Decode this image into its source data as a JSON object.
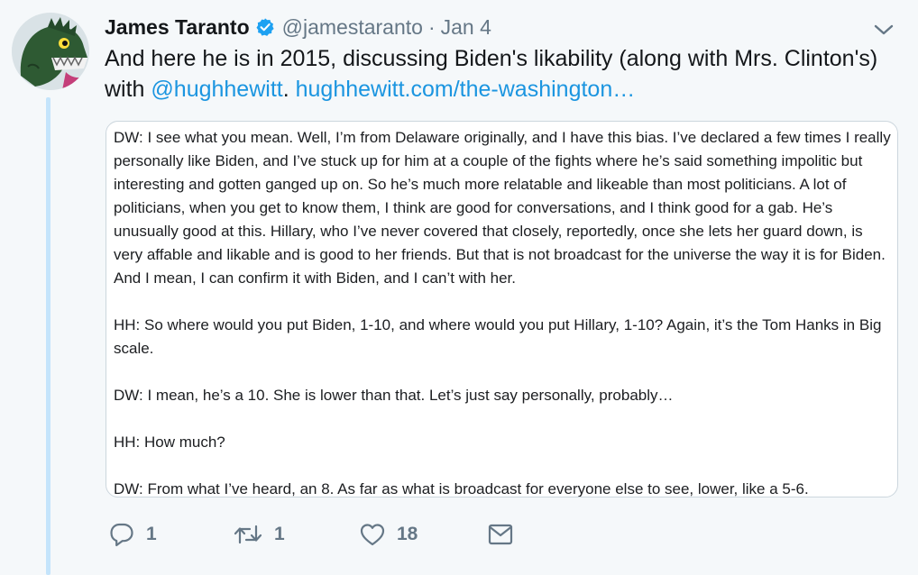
{
  "tweet": {
    "author_name": "James Taranto",
    "handle": "@jamestaranto",
    "separator": "·",
    "date": "Jan 4",
    "text_main": "And here he is in 2015, discussing Biden's likability (along with Mrs. Clinton's) with ",
    "mention": "@hughhewitt",
    "text_sep": ". ",
    "link": "hughhewitt.com/the-washington…"
  },
  "quote": {
    "paragraphs": [
      "DW: I see what you mean. Well, I’m from Delaware originally, and I have this bias. I’ve declared a few times I really personally like Biden, and I’ve stuck up for him at a couple of the fights where he’s said something impolitic but interesting and gotten ganged up on. So he’s much more relatable and likeable than most politicians. A lot of politicians, when you get to know them, I think are good for conversations, and I think good for a gab. He’s unusually good at this. Hillary, who I’ve never covered that closely, reportedly, once she lets her guard down, is very affable and likable and is good to her friends. But that is not broadcast for the universe the way it is for Biden. And I mean, I can confirm it with Biden, and I can’t with her.",
      "HH: So where would you put Biden, 1-10, and where would you put Hillary, 1-10? Again, it’s the Tom Hanks in Big scale.",
      "DW: I mean, he’s a 10. She is lower than that. Let’s just say personally, probably…",
      "HH: How much?",
      "DW: From what I’ve heard, an 8. As far as what is broadcast for everyone else to see, lower, like a 5-6."
    ]
  },
  "actions": {
    "reply_count": "1",
    "retweet_count": "1",
    "like_count": "18"
  },
  "icons": {
    "verified": "verified-badge-icon",
    "chevron": "chevron-down-icon",
    "reply": "reply-icon",
    "retweet": "retweet-icon",
    "like": "heart-icon",
    "message": "direct-message-icon"
  },
  "colors": {
    "link": "#1b95e0",
    "secondary_text": "#657786",
    "thread_line": "#c4e4fb",
    "verified": "#1da1f2"
  }
}
